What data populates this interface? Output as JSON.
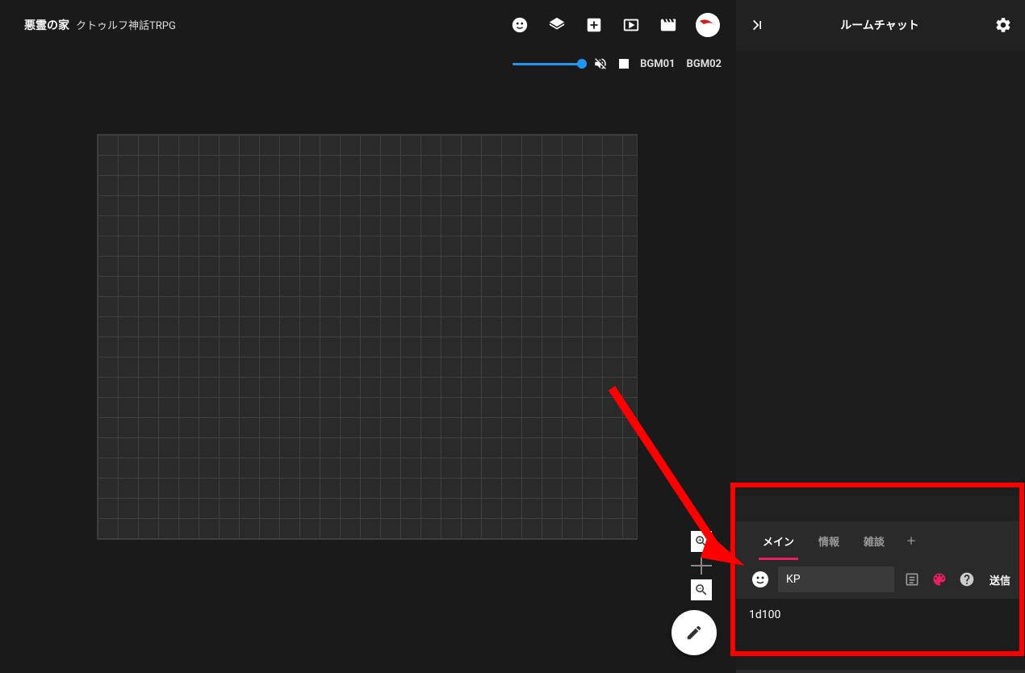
{
  "header": {
    "room_name": "悪霊の家",
    "system_name": "クトゥルフ神話TRPG"
  },
  "audio": {
    "bgm1": "BGM01",
    "bgm2": "BGM02"
  },
  "chat": {
    "title": "ルームチャット",
    "tabs": {
      "main": "メイン",
      "info": "情報",
      "ooc": "雑談"
    },
    "character_name": "KP",
    "send_label": "送信",
    "message_value": "1d100"
  },
  "colors": {
    "accent": "#e91e63",
    "primary": "#2196f3",
    "annotation": "#ff0000"
  }
}
